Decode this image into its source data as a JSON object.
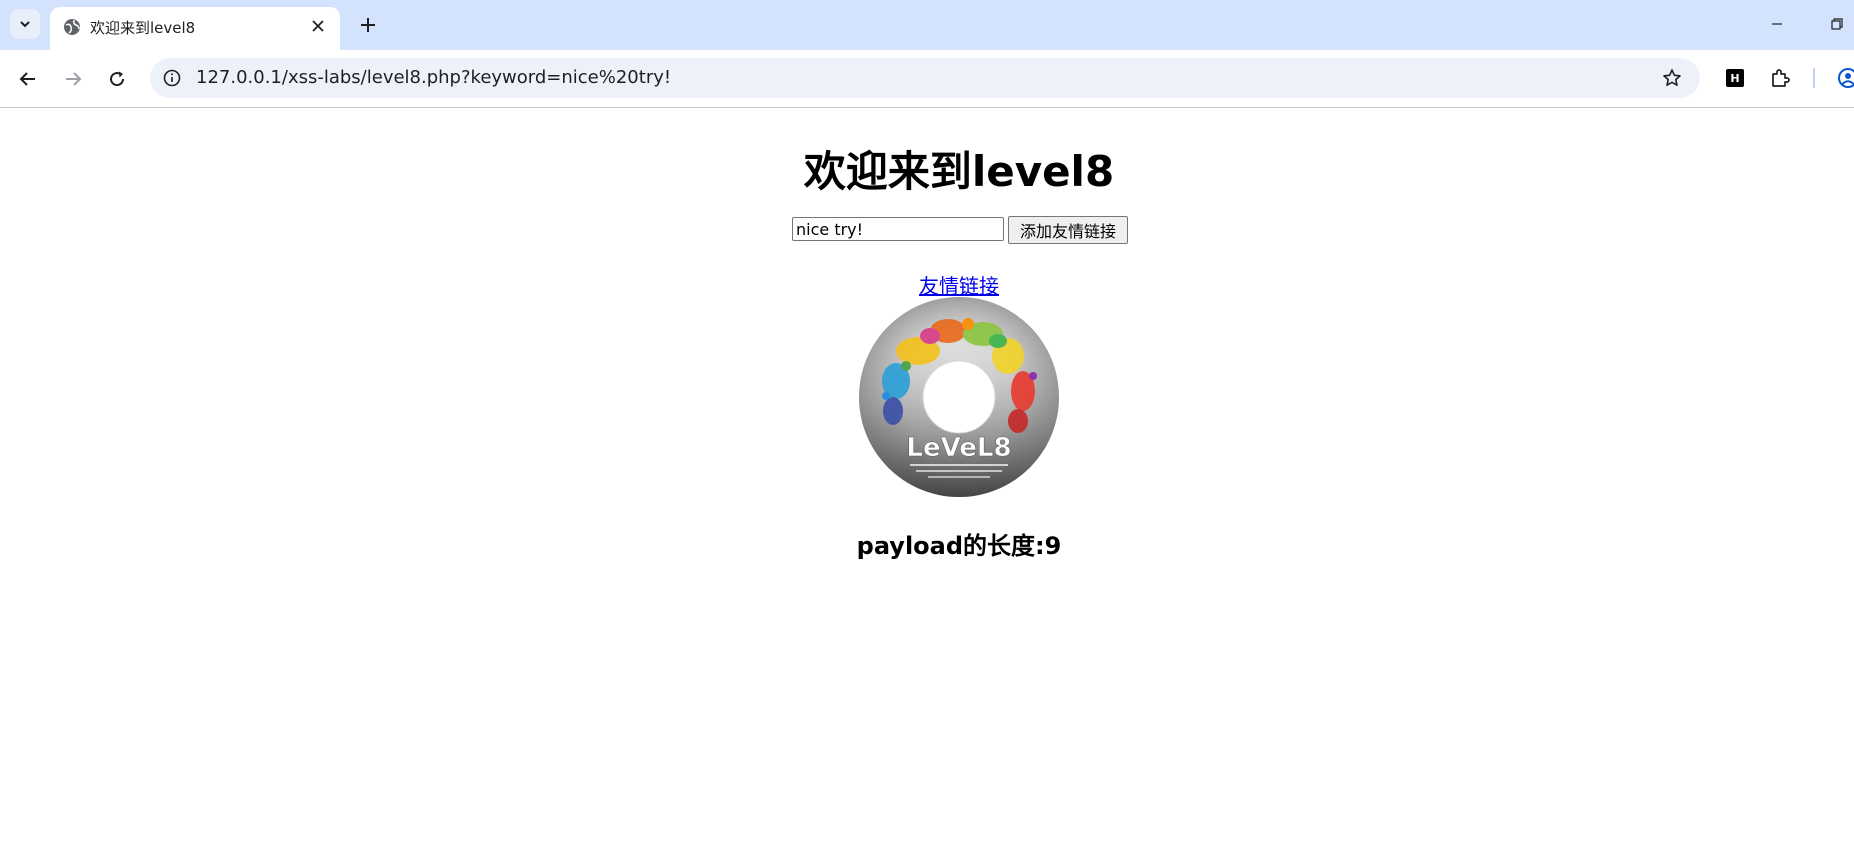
{
  "browser": {
    "tab_title": "欢迎来到level8",
    "url": "127.0.0.1/xss-labs/level8.php?keyword=nice%20try!",
    "extension_badge": "H"
  },
  "page": {
    "heading": "欢迎来到level8",
    "keyword_value": "nice try!",
    "submit_label": "添加友情链接",
    "link_text": "友情链接",
    "payload_text": "payload的长度:9",
    "disc_brand": "LeVeL8"
  }
}
